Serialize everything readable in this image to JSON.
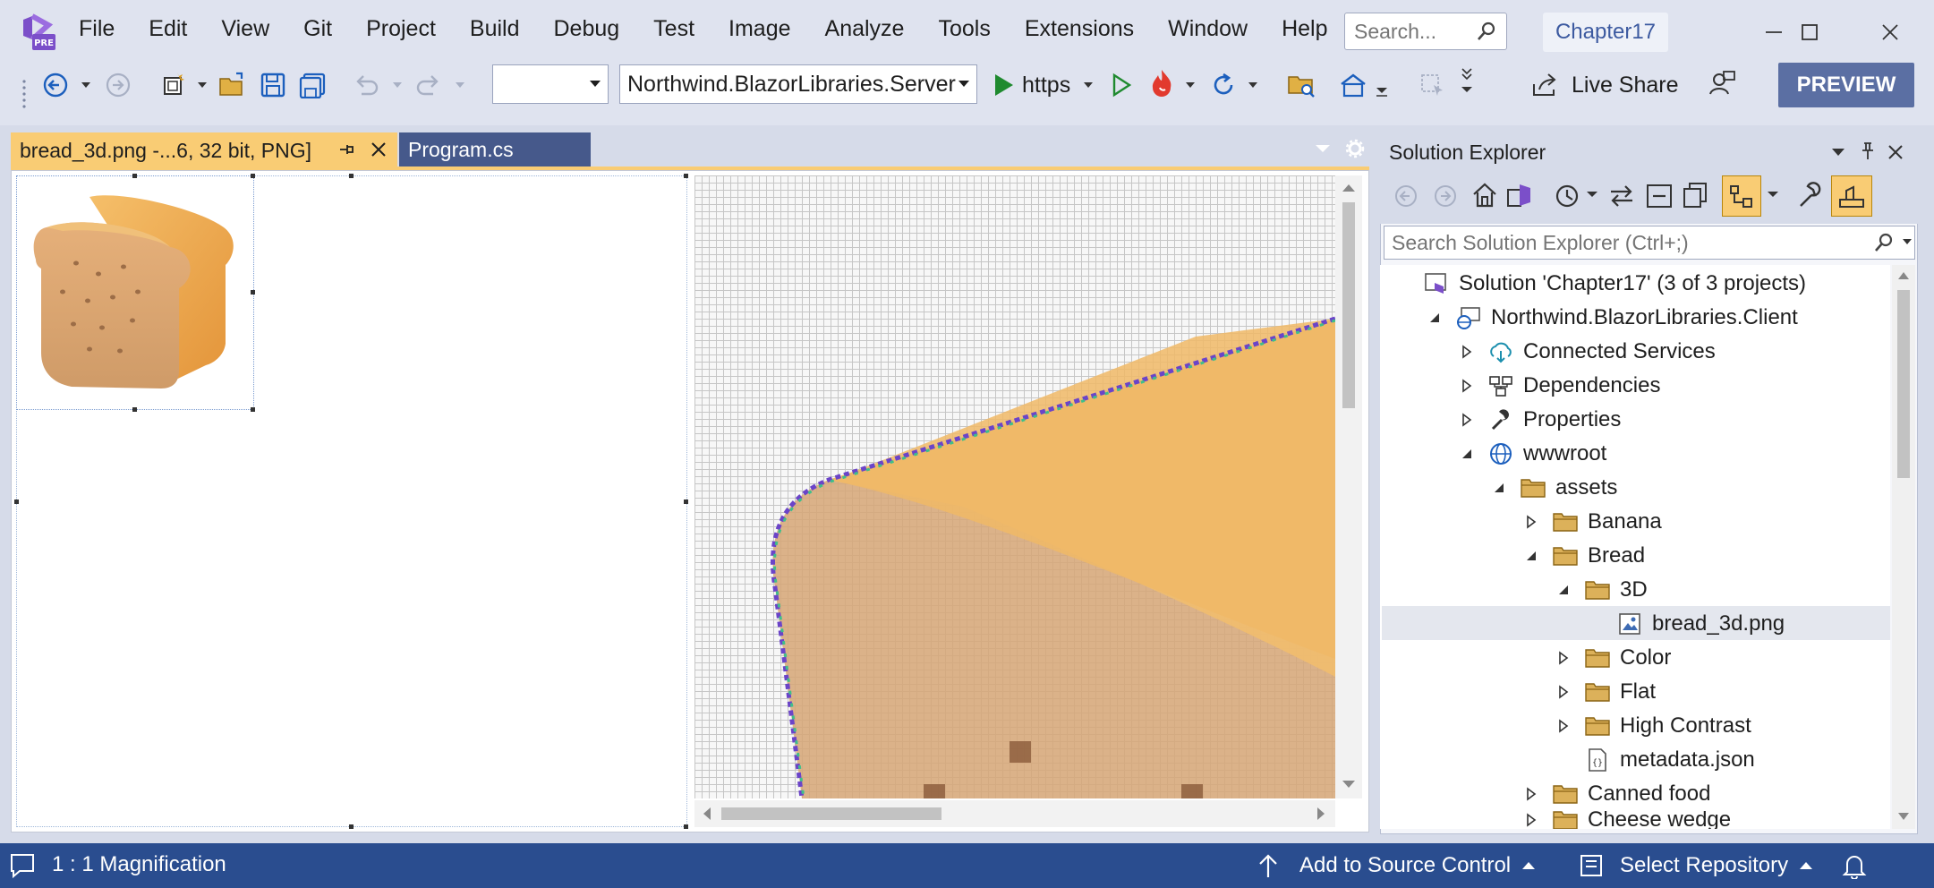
{
  "menubar": {
    "items": [
      "File",
      "Edit",
      "View",
      "Git",
      "Project",
      "Build",
      "Debug",
      "Test",
      "Image",
      "Analyze",
      "Tools",
      "Extensions",
      "Window",
      "Help"
    ],
    "search_placeholder": "Search...",
    "solution_title": "Chapter17",
    "logo_badge": "PRE"
  },
  "toolbar": {
    "config_combo_value": "",
    "startup_project": "Northwind.BlazorLibraries.Server",
    "run_profile": "https",
    "live_share_label": "Live Share",
    "preview_label": "PREVIEW"
  },
  "tabs": {
    "active_label": "bread_3d.png -...6, 32 bit, PNG]",
    "inactive_label": "Program.cs"
  },
  "solution_explorer": {
    "title": "Solution Explorer",
    "search_placeholder": "Search Solution Explorer (Ctrl+;)",
    "nodes": [
      {
        "label": "Solution 'Chapter17' (3 of 3 projects)",
        "depth": 0,
        "expander": "none",
        "icon": "solution-icon"
      },
      {
        "label": "Northwind.BlazorLibraries.Client",
        "depth": 1,
        "expander": "expanded",
        "icon": "web-project-icon"
      },
      {
        "label": "Connected Services",
        "depth": 2,
        "expander": "collapsed",
        "icon": "connected-services-icon"
      },
      {
        "label": "Dependencies",
        "depth": 2,
        "expander": "collapsed",
        "icon": "dependencies-icon"
      },
      {
        "label": "Properties",
        "depth": 2,
        "expander": "collapsed",
        "icon": "wrench-icon"
      },
      {
        "label": "wwwroot",
        "depth": 2,
        "expander": "expanded",
        "icon": "globe-icon"
      },
      {
        "label": "assets",
        "depth": 3,
        "expander": "expanded",
        "icon": "folder-icon"
      },
      {
        "label": "Banana",
        "depth": 4,
        "expander": "collapsed",
        "icon": "folder-icon"
      },
      {
        "label": "Bread",
        "depth": 4,
        "expander": "expanded",
        "icon": "folder-icon"
      },
      {
        "label": "3D",
        "depth": 5,
        "expander": "expanded",
        "icon": "folder-icon"
      },
      {
        "label": "bread_3d.png",
        "depth": 6,
        "expander": "none",
        "icon": "image-file-icon",
        "selected": true
      },
      {
        "label": "Color",
        "depth": 5,
        "expander": "collapsed",
        "icon": "folder-icon"
      },
      {
        "label": "Flat",
        "depth": 5,
        "expander": "collapsed",
        "icon": "folder-icon"
      },
      {
        "label": "High Contrast",
        "depth": 5,
        "expander": "collapsed",
        "icon": "folder-icon"
      },
      {
        "label": "metadata.json",
        "depth": 5,
        "expander": "none",
        "icon": "json-file-icon"
      },
      {
        "label": "Canned food",
        "depth": 4,
        "expander": "collapsed",
        "icon": "folder-icon"
      },
      {
        "label": "Cheese wedge",
        "depth": 4,
        "expander": "collapsed",
        "icon": "folder-icon"
      }
    ]
  },
  "statusbar": {
    "magnification": "1 : 1 Magnification",
    "source_control": "Add to Source Control",
    "repository": "Select Repository"
  },
  "colors": {
    "accent_tab": "#f9cc74",
    "status_bar": "#2a4d8f",
    "preview_button": "#5b6fa3",
    "bread_crust": "#e9a24a",
    "bread_face": "#d8a772"
  }
}
